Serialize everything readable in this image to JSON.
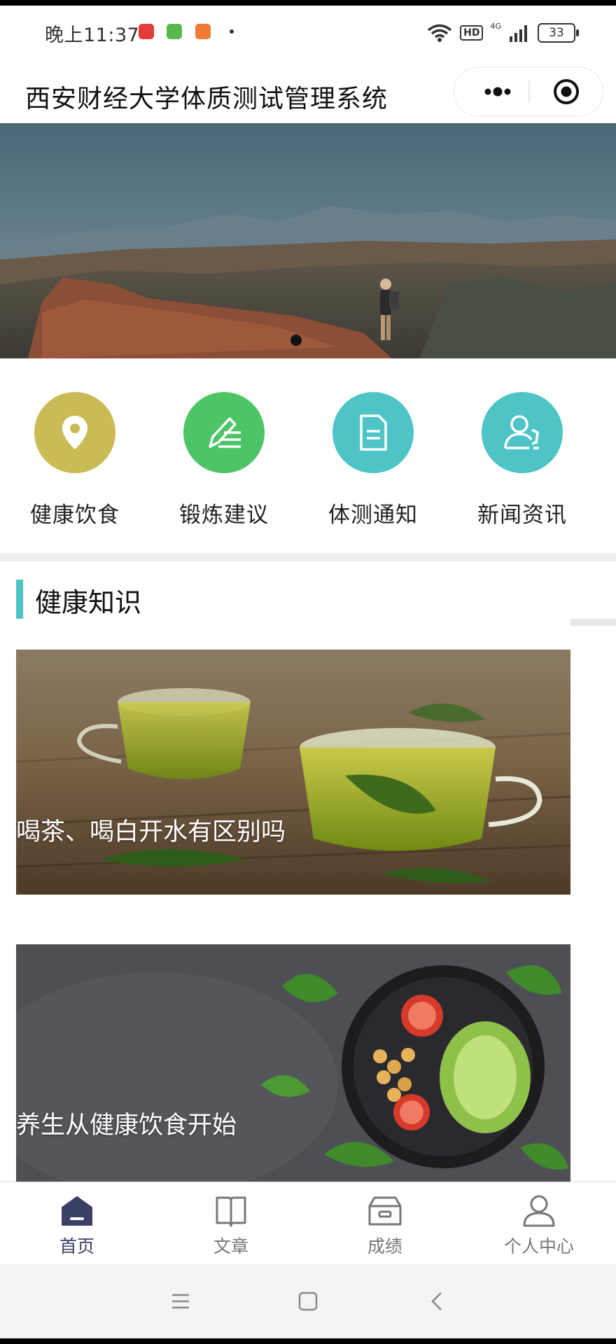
{
  "status_bar": {
    "time": "晚上11:37",
    "network": "4G",
    "hd": "HD",
    "battery": "33"
  },
  "nav": {
    "title": "西安财经大学体质测试管理系统"
  },
  "grid": [
    {
      "label": "健康饮食",
      "icon": "location-pin-icon",
      "color": "#c9bb55"
    },
    {
      "label": "锻炼建议",
      "icon": "edit-icon",
      "color": "#4dc466"
    },
    {
      "label": "体测通知",
      "icon": "document-icon",
      "color": "#4ec4c6"
    },
    {
      "label": "新闻资讯",
      "icon": "user-contact-icon",
      "color": "#4ec4c6"
    }
  ],
  "section": {
    "title": "健康知识"
  },
  "articles": [
    {
      "caption": "喝茶、喝白开水有区别吗"
    },
    {
      "caption": "养生从健康饮食开始"
    }
  ],
  "tabbar": [
    {
      "label": "首页",
      "icon": "home-icon",
      "active": true
    },
    {
      "label": "文章",
      "icon": "book-icon",
      "active": false
    },
    {
      "label": "成绩",
      "icon": "archive-box-icon",
      "active": false
    },
    {
      "label": "个人中心",
      "icon": "user-icon",
      "active": false
    }
  ],
  "colors": {
    "accent": "#4ec4c6",
    "tab_active": "#3a3f66"
  }
}
